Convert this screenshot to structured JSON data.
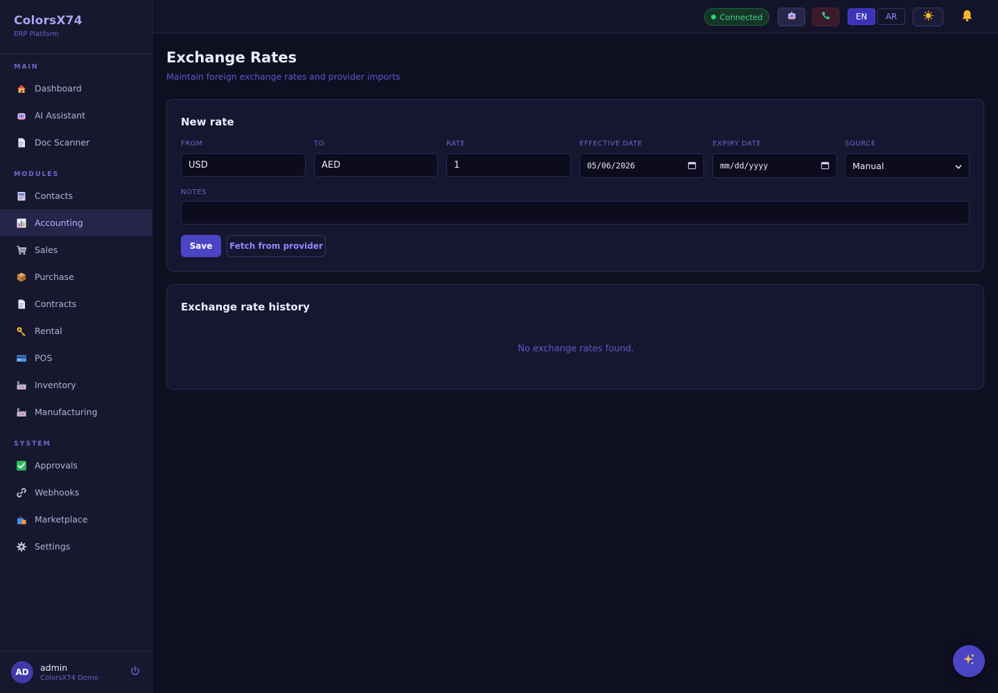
{
  "brand": {
    "name": "ColorsX74",
    "subtitle": "ERP Platform"
  },
  "sidebar": {
    "sections": [
      {
        "title": "MAIN",
        "items": [
          {
            "label": "Dashboard",
            "icon": "house-icon"
          },
          {
            "label": "AI Assistant",
            "icon": "robot-icon"
          },
          {
            "label": "Doc Scanner",
            "icon": "document-icon"
          }
        ]
      },
      {
        "title": "MODULES",
        "items": [
          {
            "label": "Contacts",
            "icon": "contacts-icon"
          },
          {
            "label": "Accounting",
            "icon": "bar-chart-icon",
            "active": true
          },
          {
            "label": "Sales",
            "icon": "cart-icon"
          },
          {
            "label": "Purchase",
            "icon": "package-icon"
          },
          {
            "label": "Contracts",
            "icon": "document-icon"
          },
          {
            "label": "Rental",
            "icon": "key-icon"
          },
          {
            "label": "POS",
            "icon": "credit-card-icon"
          },
          {
            "label": "Inventory",
            "icon": "factory-icon"
          },
          {
            "label": "Manufacturing",
            "icon": "factory-icon"
          }
        ]
      },
      {
        "title": "SYSTEM",
        "items": [
          {
            "label": "Approvals",
            "icon": "check-icon"
          },
          {
            "label": "Webhooks",
            "icon": "link-icon"
          },
          {
            "label": "Marketplace",
            "icon": "shopping-bag-icon"
          },
          {
            "label": "Settings",
            "icon": "gear-icon"
          }
        ]
      }
    ]
  },
  "user": {
    "initials": "AD",
    "name": "admin",
    "org": "ColorsX74 Demo"
  },
  "topbar": {
    "status": "Connected",
    "lang_en": "EN",
    "lang_ar": "AR"
  },
  "page": {
    "title": "Exchange Rates",
    "subtitle": "Maintain foreign exchange rates and provider imports"
  },
  "form": {
    "title": "New rate",
    "from_label": "FROM",
    "from_value": "USD",
    "to_label": "TO",
    "to_value": "AED",
    "rate_label": "RATE",
    "rate_value": "1",
    "effective_label": "EFFECTIVE DATE",
    "effective_value": "05/06/2026",
    "expiry_label": "EXPIRY DATE",
    "expiry_placeholder": "mm/dd/yyyy",
    "source_label": "SOURCE",
    "source_value": "Manual",
    "notes_label": "NOTES",
    "notes_value": "",
    "save_label": "Save",
    "fetch_label": "Fetch from provider"
  },
  "history": {
    "title": "Exchange rate history",
    "empty": "No exchange rates found."
  },
  "colors": {
    "accent": "#4b44c5",
    "background": "#0f0f22",
    "card": "#161630",
    "success": "#40d48a"
  }
}
